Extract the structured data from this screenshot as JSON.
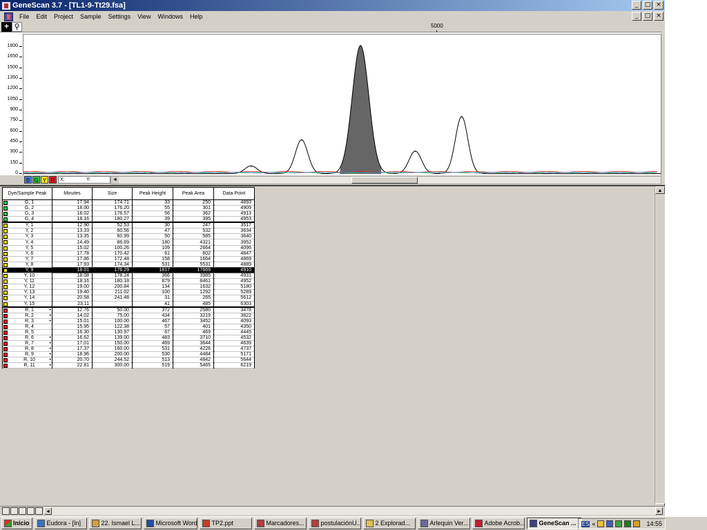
{
  "window": {
    "title": "GeneScan 3.7 - [TL1-9-Tt29.fsa]",
    "minimize_glyph": "_",
    "restore_glyph": "□",
    "close_glyph": "×"
  },
  "menu": [
    "File",
    "Edit",
    "Project",
    "Sample",
    "Settings",
    "View",
    "Windows",
    "Help"
  ],
  "toolbar": {
    "crosshair_glyph": "+",
    "zoom_glyph": "⚲",
    "x_tick_label": "5000"
  },
  "plot": {
    "y_ticks": [
      "1800",
      "1650",
      "1500",
      "1350",
      "1200",
      "1050",
      "900",
      "750",
      "600",
      "450",
      "300",
      "150",
      "0"
    ],
    "dye_buttons": [
      {
        "label": "B",
        "color": "#4a7fd8"
      },
      {
        "label": "G",
        "color": "#2ec04a"
      },
      {
        "label": "Y",
        "color": "#f0e020"
      },
      {
        "label": "R",
        "color": "#e02020"
      }
    ],
    "x_readout_label": "X:",
    "y_readout_label": "Y:",
    "fill_color": "#666666",
    "scroll_left_glyph": "◄"
  },
  "chart_data": {
    "type": "line",
    "title": "",
    "xlabel": "",
    "ylabel": "",
    "ylim": [
      0,
      1800
    ],
    "x_tick_labels": [
      "5000"
    ],
    "series": [
      {
        "name": "Y",
        "peaks": [
          {
            "x": 4780,
            "y": 110
          },
          {
            "x": 4840,
            "y": 480
          },
          {
            "x": 4910,
            "y": 1817
          },
          {
            "x": 4975,
            "y": 320
          },
          {
            "x": 5030,
            "y": 810
          }
        ],
        "highlighted_peak": {
          "x": 4910,
          "y": 1817
        }
      }
    ]
  },
  "table": {
    "headers": [
      "Dye/Sample Peak",
      "Minutes",
      "Size",
      "Peak Height",
      "Peak Area",
      "Data Point"
    ],
    "dye_colors": {
      "G": "#2ec04a",
      "Y": "#f0e020",
      "R": "#e02020"
    },
    "rows": [
      {
        "dye": "G",
        "peak": "G, 1",
        "mark": "",
        "minutes": "17.94",
        "size": "174.71",
        "height": "33",
        "area": "250",
        "point": "4893"
      },
      {
        "dye": "G",
        "peak": "G, 2",
        "mark": "",
        "minutes": "18.00",
        "size": "176.20",
        "height": "55",
        "area": "301",
        "point": "4909"
      },
      {
        "dye": "G",
        "peak": "G, 3",
        "mark": "",
        "minutes": "18.02",
        "size": "176.57",
        "height": "56",
        "area": "362",
        "point": "4913"
      },
      {
        "dye": "G",
        "peak": "G, 4",
        "mark": "",
        "minutes": "18.16",
        "size": "180.27",
        "height": "39",
        "area": "395",
        "point": "4953"
      },
      {
        "dye": "Y",
        "peak": "Y, 1",
        "mark": "",
        "minutes": "12.90",
        "size": "52.53",
        "height": "30",
        "area": "247",
        "point": "3517"
      },
      {
        "dye": "Y",
        "peak": "Y, 2",
        "mark": "",
        "minutes": "13.33",
        "size": "60.56",
        "height": "47",
        "area": "532",
        "point": "3634"
      },
      {
        "dye": "Y",
        "peak": "Y, 3",
        "mark": "",
        "minutes": "13.35",
        "size": "60.99",
        "height": "50",
        "area": "585",
        "point": "3640"
      },
      {
        "dye": "Y",
        "peak": "Y, 4",
        "mark": "",
        "minutes": "14.49",
        "size": "86.69",
        "height": "180",
        "area": "4321",
        "point": "3952"
      },
      {
        "dye": "Y",
        "peak": "Y, 5",
        "mark": "",
        "minutes": "15.02",
        "size": "100.26",
        "height": "109",
        "area": "2664",
        "point": "4096"
      },
      {
        "dye": "Y",
        "peak": "Y, 6",
        "mark": "",
        "minutes": "17.78",
        "size": "170.42",
        "height": "61",
        "area": "602",
        "point": "4847"
      },
      {
        "dye": "Y",
        "peak": "Y, 7",
        "mark": "",
        "minutes": "17.86",
        "size": "172.48",
        "height": "158",
        "area": "1664",
        "point": "4869"
      },
      {
        "dye": "Y",
        "peak": "Y, 8",
        "mark": "",
        "minutes": "17.93",
        "size": "174.34",
        "height": "531",
        "area": "5531",
        "point": "4889"
      },
      {
        "dye": "Y",
        "peak": "Y, 9",
        "mark": "",
        "minutes": "18.01",
        "size": "176.29",
        "height": "1817",
        "area": "17669",
        "point": "4910",
        "selected": true
      },
      {
        "dye": "Y",
        "peak": "Y, 10",
        "mark": "",
        "minutes": "18.08",
        "size": "178.24",
        "height": "366",
        "area": "3985",
        "point": "4931"
      },
      {
        "dye": "Y",
        "peak": "Y, 11",
        "mark": "",
        "minutes": "18.16",
        "size": "180.18",
        "height": "879",
        "area": "8461",
        "point": "4952"
      },
      {
        "dye": "Y",
        "peak": "Y, 12",
        "mark": "",
        "minutes": "19.00",
        "size": "200.84",
        "height": "134",
        "area": "1632",
        "point": "5180"
      },
      {
        "dye": "Y",
        "peak": "Y, 13",
        "mark": "",
        "minutes": "19.40",
        "size": "211.02",
        "height": "100",
        "area": "1292",
        "point": "5289"
      },
      {
        "dye": "Y",
        "peak": "Y, 14",
        "mark": "",
        "minutes": "20.58",
        "size": "241.48",
        "height": "31",
        "area": "265",
        "point": "5612"
      },
      {
        "dye": "Y",
        "peak": "Y, 15",
        "mark": "",
        "minutes": "23.11",
        "size": "",
        "height": "41",
        "area": "485",
        "point": "6303"
      },
      {
        "dye": "R",
        "peak": "R, 1",
        "mark": "•",
        "minutes": "12.76",
        "size": "50.00",
        "height": "372",
        "area": "2580",
        "point": "3478"
      },
      {
        "dye": "R",
        "peak": "R, 2",
        "mark": "•",
        "minutes": "14.02",
        "size": "75.00",
        "height": "434",
        "area": "3219",
        "point": "3822"
      },
      {
        "dye": "R",
        "peak": "R, 3",
        "mark": "•",
        "minutes": "15.01",
        "size": "100.00",
        "height": "467",
        "area": "3452",
        "point": "4093"
      },
      {
        "dye": "R",
        "peak": "R, 4",
        "mark": "",
        "minutes": "15.95",
        "size": "122.38",
        "height": "57",
        "area": "401",
        "point": "4350"
      },
      {
        "dye": "R",
        "peak": "R, 5",
        "mark": "",
        "minutes": "16.30",
        "size": "130.97",
        "height": "67",
        "area": "469",
        "point": "4445"
      },
      {
        "dye": "R",
        "peak": "R, 6",
        "mark": "•",
        "minutes": "16.62",
        "size": "139.00",
        "height": "483",
        "area": "3710",
        "point": "4532"
      },
      {
        "dye": "R",
        "peak": "R, 7",
        "mark": "•",
        "minutes": "17.01",
        "size": "150.00",
        "height": "469",
        "area": "3644",
        "point": "4639"
      },
      {
        "dye": "R",
        "peak": "R, 8",
        "mark": "•",
        "minutes": "17.37",
        "size": "160.00",
        "height": "531",
        "area": "4226",
        "point": "4737"
      },
      {
        "dye": "R",
        "peak": "R, 9",
        "mark": "•",
        "minutes": "18.96",
        "size": "200.00",
        "height": "530",
        "area": "4484",
        "point": "5171"
      },
      {
        "dye": "R",
        "peak": "R, 10",
        "mark": "•",
        "minutes": "20.70",
        "size": "244.52",
        "height": "513",
        "area": "4842",
        "point": "5644"
      },
      {
        "dye": "R",
        "peak": "R, 11",
        "mark": "•",
        "minutes": "22.81",
        "size": "300.00",
        "height": "519",
        "area": "5465",
        "point": "6219"
      }
    ]
  },
  "scroll": {
    "up_glyph": "▲",
    "down_glyph": "▼",
    "left_glyph": "◄",
    "right_glyph": "►"
  },
  "taskbar": {
    "start_label": "Inicio",
    "buttons": [
      {
        "label": "Eudora - [In]",
        "active": false
      },
      {
        "label": "22. Ismael L...",
        "active": false
      },
      {
        "label": "Microsoft Word",
        "active": false
      },
      {
        "label": "TP2.ppt",
        "active": false
      },
      {
        "label": "Marcadores...",
        "active": false
      },
      {
        "label": "postulaciónU...",
        "active": false
      },
      {
        "label": "2 Explorad...",
        "active": false
      },
      {
        "label": "Arlequin Ver...",
        "active": false
      },
      {
        "label": "Adobe Acrob...",
        "active": false
      },
      {
        "label": "GeneScan ...",
        "active": true
      }
    ],
    "lang": "ES",
    "chevron": "«",
    "clock": "14:55"
  }
}
